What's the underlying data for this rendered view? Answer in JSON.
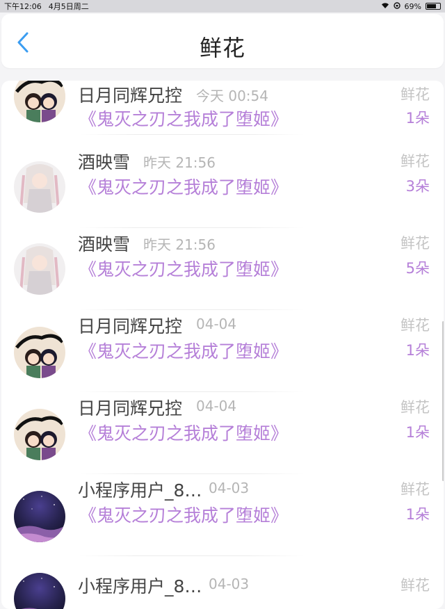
{
  "status_bar": {
    "time": "下午12:06",
    "date": "4月5日周二",
    "battery": "69%"
  },
  "header": {
    "title": "鲜花",
    "back_icon": "chevron-left-icon"
  },
  "records": [
    {
      "user": "日月同辉兄控",
      "time": "今天 00:54",
      "book": "《鬼灭之刃之我成了堕姬》",
      "gift": "鲜花",
      "count": "1朵",
      "avatar": "anime-pair"
    },
    {
      "user": "酒映雪",
      "time": "昨天 21:56",
      "book": "《鬼灭之刃之我成了堕姬》",
      "gift": "鲜花",
      "count": "3朵",
      "avatar": "white-hair-girl"
    },
    {
      "user": "酒映雪",
      "time": "昨天 21:56",
      "book": "《鬼灭之刃之我成了堕姬》",
      "gift": "鲜花",
      "count": "5朵",
      "avatar": "white-hair-girl"
    },
    {
      "user": "日月同辉兄控",
      "time": "04-04",
      "book": "《鬼灭之刃之我成了堕姬》",
      "gift": "鲜花",
      "count": "1朵",
      "avatar": "anime-pair"
    },
    {
      "user": "日月同辉兄控",
      "time": "04-04",
      "book": "《鬼灭之刃之我成了堕姬》",
      "gift": "鲜花",
      "count": "1朵",
      "avatar": "anime-pair"
    },
    {
      "user": "小程序用户_8…",
      "time": "04-03",
      "book": "《鬼灭之刃之我成了堕姬》",
      "gift": "鲜花",
      "count": "1朵",
      "avatar": "night-sky"
    },
    {
      "user": "小程序用户_8…",
      "time": "04-03",
      "book": "",
      "gift": "鲜花",
      "count": "",
      "avatar": "night-sky"
    }
  ],
  "colors": {
    "accent_blue": "#3b9df1",
    "book_purple": "#b57fd8",
    "muted_gray": "#c4c4c4"
  }
}
